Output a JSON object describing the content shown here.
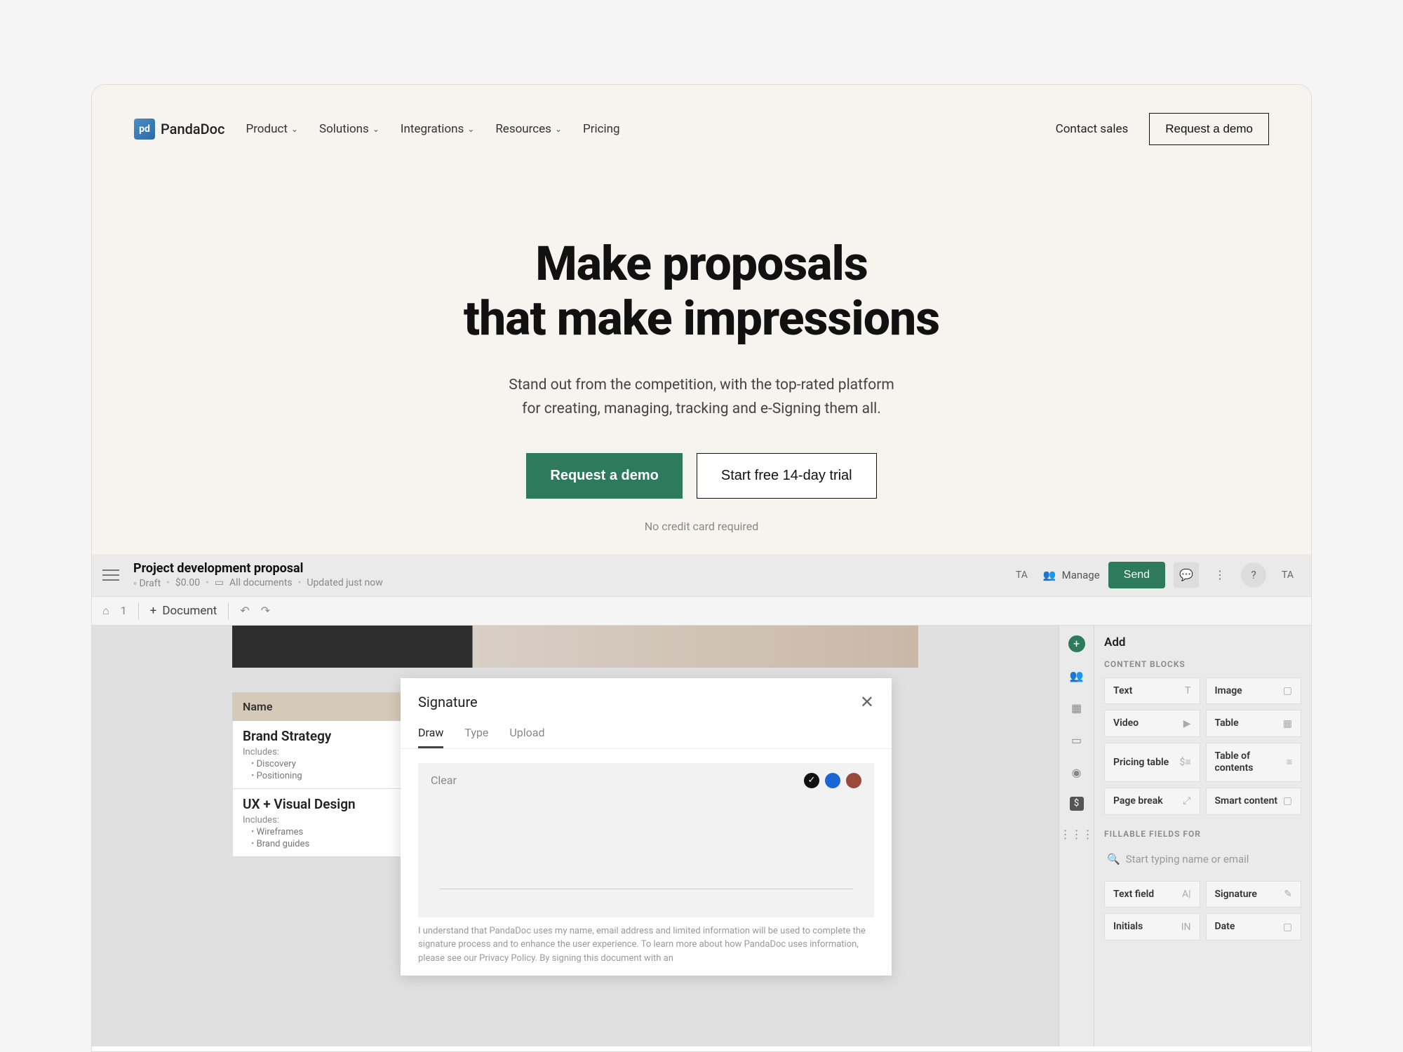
{
  "brand": {
    "name": "PandaDoc",
    "badge": "pd"
  },
  "nav": {
    "items": [
      {
        "label": "Product",
        "dropdown": true
      },
      {
        "label": "Solutions",
        "dropdown": true
      },
      {
        "label": "Integrations",
        "dropdown": true
      },
      {
        "label": "Resources",
        "dropdown": true
      },
      {
        "label": "Pricing",
        "dropdown": false
      }
    ],
    "contact_sales": "Contact sales",
    "request_demo": "Request a demo"
  },
  "hero": {
    "title_l1": "Make proposals",
    "title_l2": "that make impressions",
    "sub_l1": "Stand out from the competition, with the top-rated platform",
    "sub_l2": "for creating, managing, tracking and e-Signing them all.",
    "cta_primary": "Request a demo",
    "cta_secondary": "Start free 14-day trial",
    "note": "No credit card required"
  },
  "app": {
    "project_title": "Project development proposal",
    "meta": {
      "status": "Draft",
      "price": "$0.00",
      "folder": "All documents",
      "updated": "Updated just now"
    },
    "manage": "Manage",
    "avatar": "TA",
    "avatar2": "TA",
    "send": "Send",
    "toolbar": {
      "count": "1",
      "document": "Document"
    }
  },
  "doc": {
    "name_header": "Name",
    "sections": [
      {
        "title": "Brand Strategy",
        "sub": "Includes:",
        "items": [
          "Discovery",
          "Positioning"
        ]
      },
      {
        "title": "UX + Visual Design",
        "sub": "Includes:",
        "items": [
          "Wireframes",
          "Brand guides"
        ]
      }
    ]
  },
  "signature": {
    "title": "Signature",
    "tabs": [
      "Draw",
      "Type",
      "Upload"
    ],
    "active_tab": 0,
    "clear": "Clear",
    "disclaimer": "I understand that PandaDoc uses my name, email address and limited information will be used to complete the signature process and to enhance the user experience. To learn more about how PandaDoc uses information, please see our Privacy Policy. By signing this document with an"
  },
  "panel": {
    "title": "Add",
    "content_blocks_label": "CONTENT BLOCKS",
    "blocks": [
      {
        "label": "Text",
        "icon": "T"
      },
      {
        "label": "Image",
        "icon": "▢"
      },
      {
        "label": "Video",
        "icon": "▶"
      },
      {
        "label": "Table",
        "icon": "▦"
      },
      {
        "label": "Pricing table",
        "icon": "$≡"
      },
      {
        "label": "Table of contents",
        "icon": "≡"
      },
      {
        "label": "Page break",
        "icon": "⤢"
      },
      {
        "label": "Smart content",
        "icon": "▢"
      }
    ],
    "fillable_label": "FILLABLE FIELDS FOR",
    "search_placeholder": "Start typing name or email",
    "fields": [
      {
        "label": "Text field",
        "icon": "A|"
      },
      {
        "label": "Signature",
        "icon": "✎"
      },
      {
        "label": "Initials",
        "icon": "IN"
      },
      {
        "label": "Date",
        "icon": "▢"
      }
    ]
  }
}
